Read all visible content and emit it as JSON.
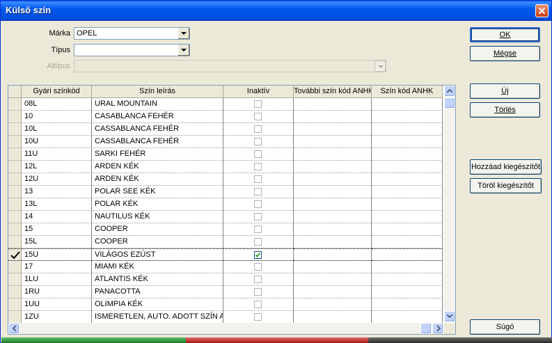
{
  "window": {
    "title": "Külső szín"
  },
  "form": {
    "marka_label": "Márka",
    "marka_value": "OPEL",
    "tipus_label": "Típus",
    "tipus_value": "",
    "altipus_label": "Altípus",
    "altipus_value": ""
  },
  "buttons": {
    "ok": "OK",
    "megse": "Mégse",
    "uj": "Új",
    "torles": "Törlés",
    "hozzaad": "Hozzáad kiegészítőt",
    "torol": "Töröl kiegészítőt",
    "sugo": "Súgó"
  },
  "grid": {
    "headers": [
      "Gyári színkód",
      "Szín leírás",
      "Inaktív",
      "További szín kód ANHK",
      "Szín kód ANHK"
    ],
    "rows": [
      {
        "code": "08L",
        "desc": "URAL MOUNTAIN",
        "inactive": false,
        "extra": "",
        "anhk": ""
      },
      {
        "code": "10",
        "desc": "CASABLANCA FEHÉR",
        "inactive": false,
        "extra": "",
        "anhk": ""
      },
      {
        "code": "10L",
        "desc": "CASSABLANCA FEHÉR",
        "inactive": false,
        "extra": "",
        "anhk": ""
      },
      {
        "code": "10U",
        "desc": "CASSABLANCA FEHÉR",
        "inactive": false,
        "extra": "",
        "anhk": ""
      },
      {
        "code": "11U",
        "desc": "SARKI FEHÉR",
        "inactive": false,
        "extra": "",
        "anhk": ""
      },
      {
        "code": "12L",
        "desc": "ARDEN KÉK",
        "inactive": false,
        "extra": "",
        "anhk": ""
      },
      {
        "code": "12U",
        "desc": "ARDEN KÉK",
        "inactive": false,
        "extra": "",
        "anhk": ""
      },
      {
        "code": "13",
        "desc": "POLAR SEE KÉK",
        "inactive": false,
        "extra": "",
        "anhk": ""
      },
      {
        "code": "13L",
        "desc": "POLAR KÉK",
        "inactive": false,
        "extra": "",
        "anhk": ""
      },
      {
        "code": "14",
        "desc": "NAUTILUS KÉK",
        "inactive": false,
        "extra": "",
        "anhk": ""
      },
      {
        "code": "15",
        "desc": "COOPER",
        "inactive": false,
        "extra": "",
        "anhk": ""
      },
      {
        "code": "15L",
        "desc": "COOPER",
        "inactive": false,
        "extra": "",
        "anhk": ""
      },
      {
        "code": "15U",
        "desc": "VILÁGOS EZÜST",
        "inactive": true,
        "extra": "",
        "anhk": "",
        "current": true
      },
      {
        "code": "17",
        "desc": "MIAMI KÉK",
        "inactive": false,
        "extra": "",
        "anhk": ""
      },
      {
        "code": "1LU",
        "desc": "ATLANTIS KÉK",
        "inactive": false,
        "extra": "",
        "anhk": ""
      },
      {
        "code": "1RU",
        "desc": "PANACOTTA",
        "inactive": false,
        "extra": "",
        "anhk": ""
      },
      {
        "code": "1UU",
        "desc": "OLIMPIA KÉK",
        "inactive": false,
        "extra": "",
        "anhk": ""
      },
      {
        "code": "1ZU",
        "desc": "ISMERETLEN, AUTO. ADOTT SZÍN A",
        "inactive": false,
        "extra": "",
        "anhk": ""
      }
    ],
    "current_row_marker_icon": "checkmark-icon"
  },
  "colors": {
    "title_bar": "#0058ee",
    "close_button": "#d8582e",
    "status_green": "#2e8b3e",
    "status_red": "#c8282e"
  }
}
